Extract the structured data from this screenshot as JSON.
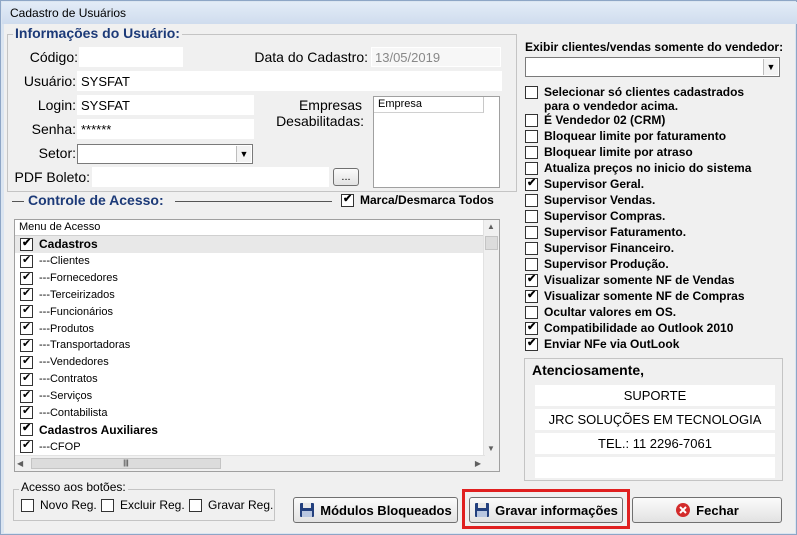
{
  "window": {
    "title": "Cadastro de Usuários"
  },
  "user_info": {
    "section_title": "Informações do Usuário:",
    "codigo_label": "Código:",
    "codigo_value": "",
    "data_cadastro_label": "Data do Cadastro:",
    "data_cadastro_value": "13/05/2019",
    "usuario_label": "Usuário:",
    "usuario_value": "SYSFAT",
    "login_label": "Login:",
    "login_value": "SYSFAT",
    "senha_label": "Senha:",
    "senha_value": "******",
    "setor_label": "Setor:",
    "setor_value": "",
    "pdf_boleto_label": "PDF Boleto:",
    "pdf_boleto_value": "",
    "browse_label": "...",
    "empresas_label_1": "Empresas",
    "empresas_label_2": "Desabilitadas:",
    "empresa_col_header": "Empresa"
  },
  "access_control": {
    "section_title": "Controle de Acesso:",
    "toggle_all_label": "Marca/Desmarca Todos",
    "toggle_all_checked": true,
    "list_header": "Menu de Acesso",
    "items": [
      {
        "label": "Cadastros",
        "checked": true,
        "bold": true
      },
      {
        "label": "---Clientes",
        "checked": true,
        "bold": false
      },
      {
        "label": "---Fornecedores",
        "checked": true,
        "bold": false
      },
      {
        "label": "---Terceirizados",
        "checked": true,
        "bold": false
      },
      {
        "label": "---Funcionários",
        "checked": true,
        "bold": false
      },
      {
        "label": "---Produtos",
        "checked": true,
        "bold": false
      },
      {
        "label": "---Transportadoras",
        "checked": true,
        "bold": false
      },
      {
        "label": "---Vendedores",
        "checked": true,
        "bold": false
      },
      {
        "label": "---Contratos",
        "checked": true,
        "bold": false
      },
      {
        "label": "---Serviços",
        "checked": true,
        "bold": false
      },
      {
        "label": "---Contabilista",
        "checked": true,
        "bold": false
      },
      {
        "label": "Cadastros Auxiliares",
        "checked": true,
        "bold": true
      },
      {
        "label": "---CFOP",
        "checked": true,
        "bold": false
      }
    ]
  },
  "button_access": {
    "title": "Acesso aos botões:",
    "novo_label": "Novo Reg.",
    "excluir_label": "Excluir Reg.",
    "gravar_label": "Gravar Reg."
  },
  "right_panel": {
    "vendor_filter_label": "Exibir clientes/vendas somente do vendedor:",
    "vendor_filter_value": "",
    "options": [
      {
        "label": "Selecionar só clientes cadastrados",
        "label2": "para o vendedor acima.",
        "checked": false
      },
      {
        "label": "É Vendedor 02 (CRM)",
        "checked": false
      },
      {
        "label": "Bloquear limite por faturamento",
        "checked": false
      },
      {
        "label": "Bloquear limite por atraso",
        "checked": false
      },
      {
        "label": "Atualiza preços no inicio do sistema",
        "checked": false
      },
      {
        "label": "Supervisor Geral.",
        "checked": true
      },
      {
        "label": "Supervisor Vendas.",
        "checked": false
      },
      {
        "label": "Supervisor Compras.",
        "checked": false
      },
      {
        "label": "Supervisor Faturamento.",
        "checked": false
      },
      {
        "label": "Supervisor Financeiro.",
        "checked": false
      },
      {
        "label": "Supervisor Produção.",
        "checked": false
      },
      {
        "label": "Visualizar somente NF de Vendas",
        "checked": true
      },
      {
        "label": "Visualizar somente NF de Compras",
        "checked": true
      },
      {
        "label": "Ocultar valores em OS.",
        "checked": false
      },
      {
        "label": "Compatibilidade ao Outlook 2010",
        "checked": true
      },
      {
        "label": "Enviar NFe via OutLook",
        "checked": true
      }
    ],
    "signature": {
      "title": "Atenciosamente,",
      "line1": "SUPORTE",
      "line2": "JRC SOLUÇÕES EM TECNOLOGIA",
      "line3": "TEL.: 11 2296-7061",
      "line4": ""
    }
  },
  "buttons": {
    "modulos_label": "Módulos Bloqueados",
    "gravar_label": "Gravar informações",
    "fechar_label": "Fechar"
  },
  "colors": {
    "highlight": "#e02020",
    "section_title": "#1c3a78"
  }
}
